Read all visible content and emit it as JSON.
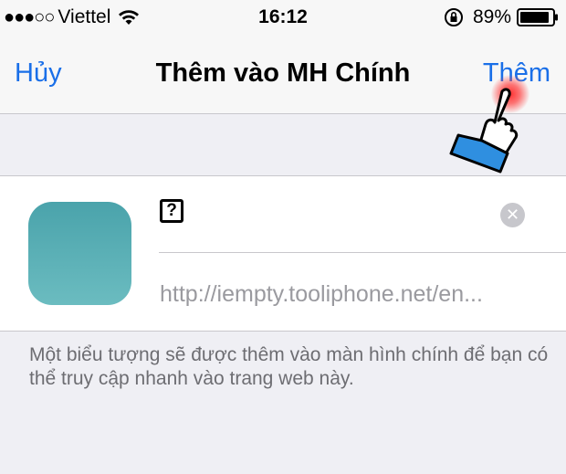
{
  "status_bar": {
    "signal_dots": "●●●○○",
    "carrier": "Viettel",
    "time": "16:12",
    "battery": "89%"
  },
  "nav": {
    "cancel_label": "Hủy",
    "title": "Thêm vào MH Chính",
    "add_label": "Thêm"
  },
  "bookmark": {
    "favicon_glyph": "?",
    "url": "http://iempty.tooliphone.net/en..."
  },
  "footnote": "Một biểu tượng sẽ được thêm vào màn hình chính để bạn có thể truy cập nhanh vào trang web này.",
  "colors": {
    "accent": "#1a6fe8",
    "icon_gradient_top": "#4aa3ab",
    "icon_gradient_bottom": "#6bbcc0",
    "tap_indicator": "#ff2828"
  }
}
